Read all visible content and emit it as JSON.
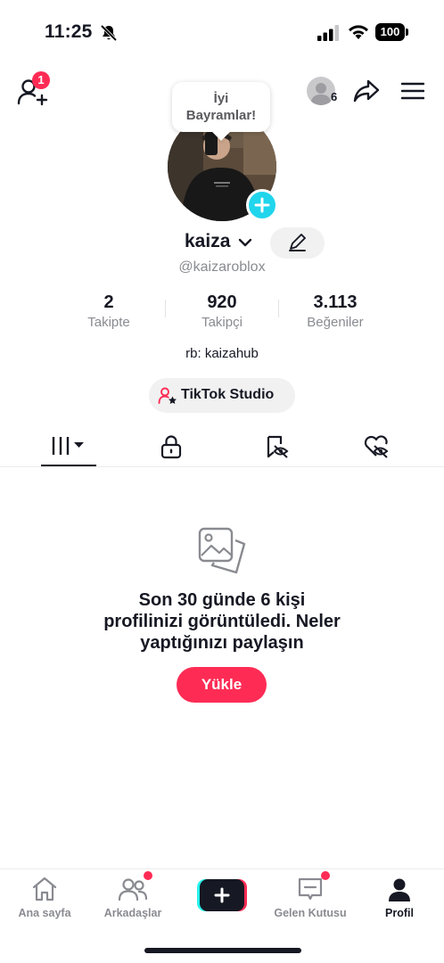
{
  "status_bar": {
    "time": "11:25",
    "battery": "100"
  },
  "top_nav": {
    "friend_requests_badge": "1",
    "profile_views_count": "6"
  },
  "avatar_bubble": {
    "line1": "İyi",
    "line2": "Bayramlar!"
  },
  "profile": {
    "username": "kaiza",
    "handle": "@kaizaroblox",
    "bio": "rb: kaizahub"
  },
  "stats": [
    {
      "value": "2",
      "label": "Takipte"
    },
    {
      "value": "920",
      "label": "Takipçi"
    },
    {
      "value": "3.113",
      "label": "Beğeniler"
    }
  ],
  "studio_button": {
    "label": "TikTok Studio"
  },
  "tabs": [
    {
      "icon": "grid-icon",
      "active": true
    },
    {
      "icon": "lock-icon",
      "active": false
    },
    {
      "icon": "bookmark-icon",
      "active": false
    },
    {
      "icon": "heart-hidden-icon",
      "active": false
    }
  ],
  "empty_state": {
    "line1": "Son 30 günde 6 kişi",
    "line2": "profilinizi görüntüledi. Neler",
    "line3": "yaptığınızı paylaşın",
    "upload_label": "Yükle"
  },
  "bottom_nav": {
    "home": "Ana sayfa",
    "friends": "Arkadaşlar",
    "inbox": "Gelen Kutusu",
    "profile": "Profil"
  },
  "colors": {
    "accent": "#fe2c55",
    "cyan": "#20d5ec",
    "text": "#161823",
    "muted": "#8a8b91"
  }
}
